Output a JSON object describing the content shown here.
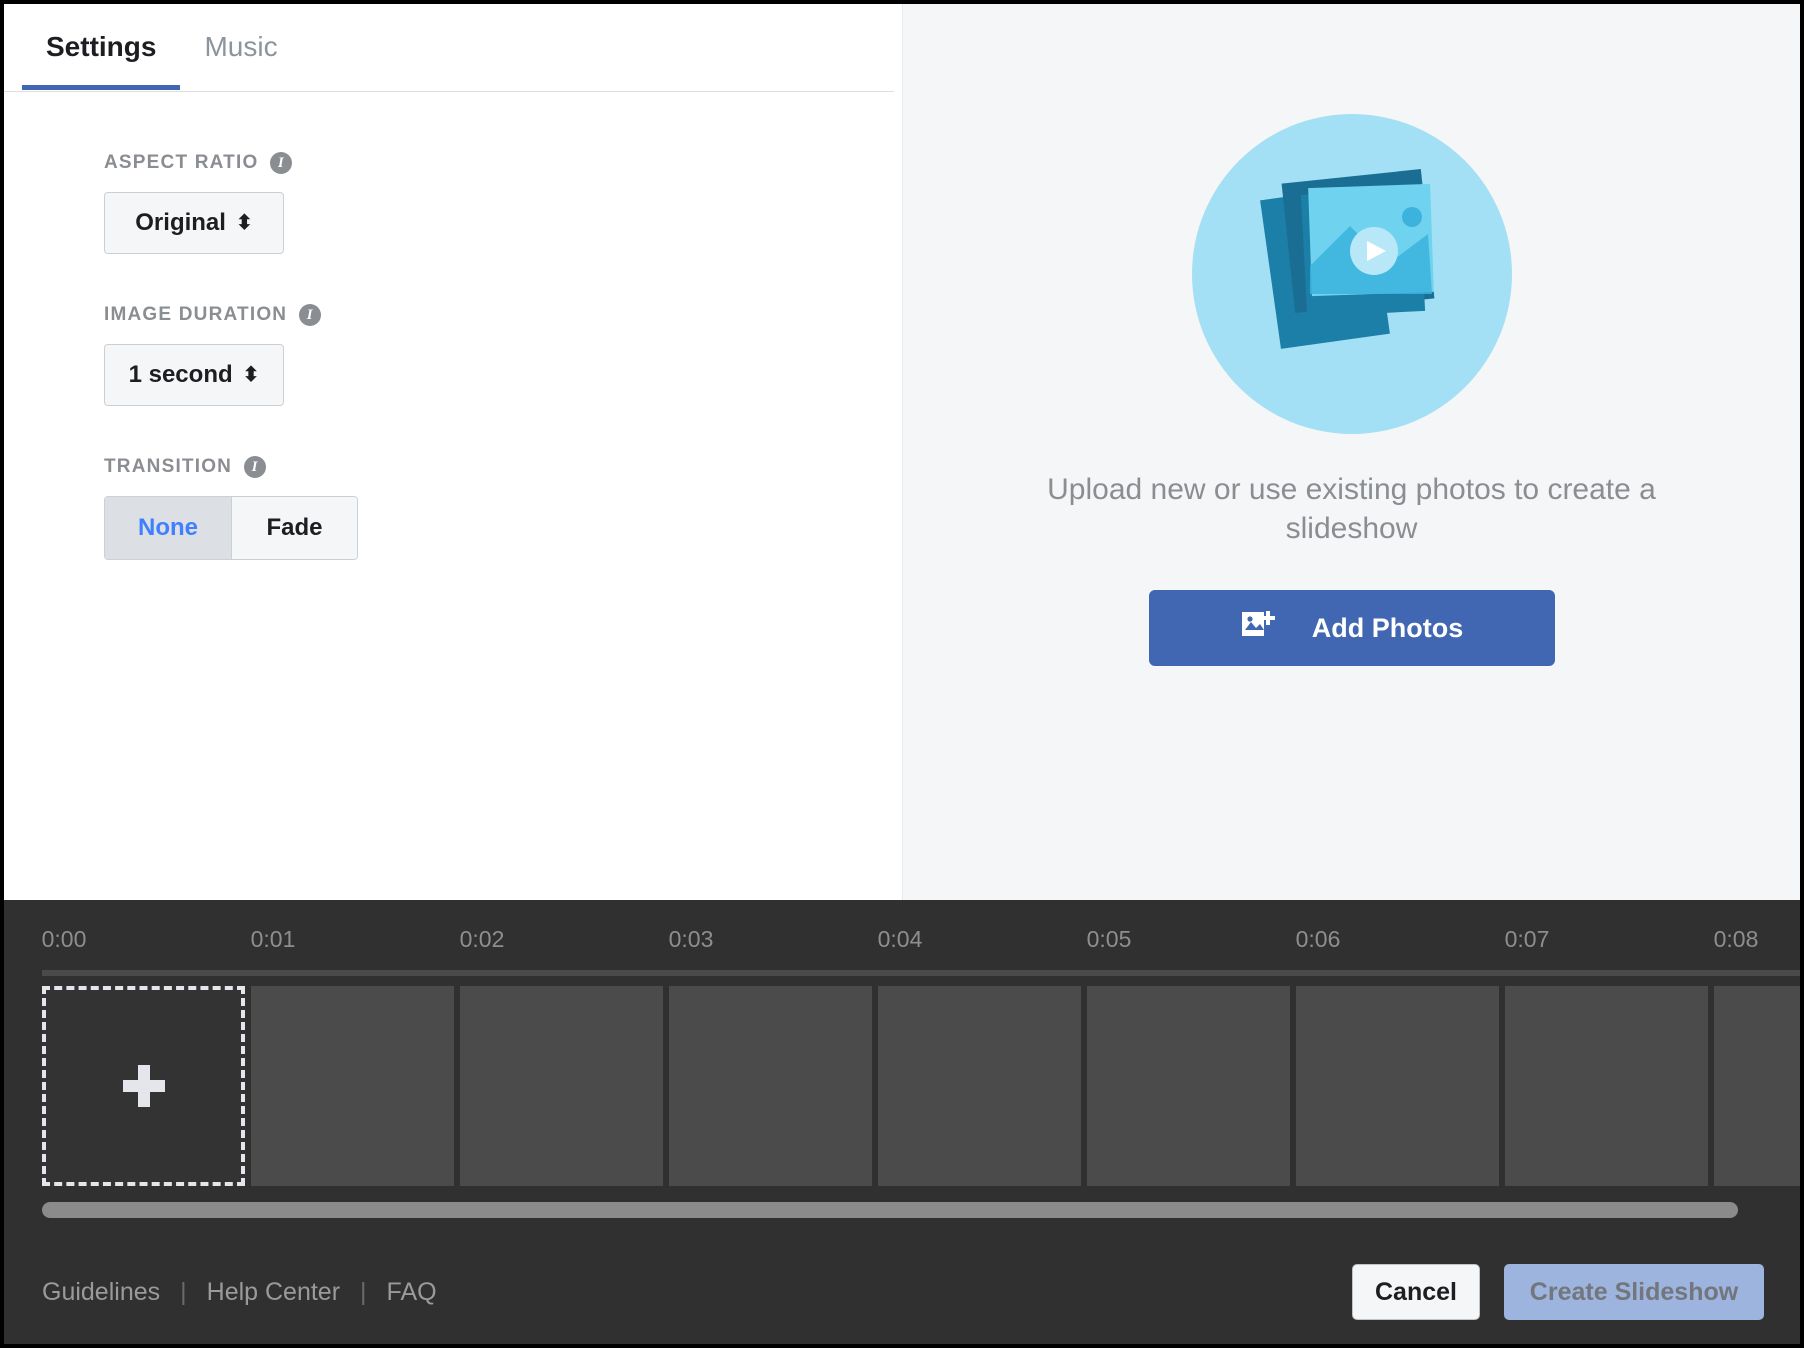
{
  "tabs": [
    {
      "label": "Settings",
      "active": true
    },
    {
      "label": "Music",
      "active": false
    }
  ],
  "settings": {
    "aspect_ratio": {
      "label": "ASPECT RATIO",
      "value": "Original",
      "info_icon": "info-icon"
    },
    "image_duration": {
      "label": "IMAGE DURATION",
      "value": "1 second",
      "info_icon": "info-icon"
    },
    "transition": {
      "label": "TRANSITION",
      "info_icon": "info-icon",
      "options": [
        {
          "label": "None",
          "selected": true
        },
        {
          "label": "Fade",
          "selected": false
        }
      ]
    }
  },
  "preview": {
    "illustration_icon": "photo-stack-video-icon",
    "empty_text": "Upload new or use existing photos to create a slideshow",
    "add_button": {
      "label": "Add Photos",
      "icon": "add-photo-icon",
      "color": "#4267b2"
    }
  },
  "timeline": {
    "ticks": [
      "0:00",
      "0:01",
      "0:02",
      "0:03",
      "0:04",
      "0:05",
      "0:06",
      "0:07",
      "0:08"
    ],
    "add_frame_icon": "plus-icon",
    "empty_frame_count": 8
  },
  "footer": {
    "links": [
      "Guidelines",
      "Help Center",
      "FAQ"
    ],
    "separator": "|",
    "cancel_label": "Cancel",
    "create_label": "Create Slideshow"
  },
  "colors": {
    "accent_blue": "#4267b2",
    "selected_text": "#4080ff",
    "panel_bg": "#f5f6f7",
    "timeline_bg": "#303030"
  }
}
